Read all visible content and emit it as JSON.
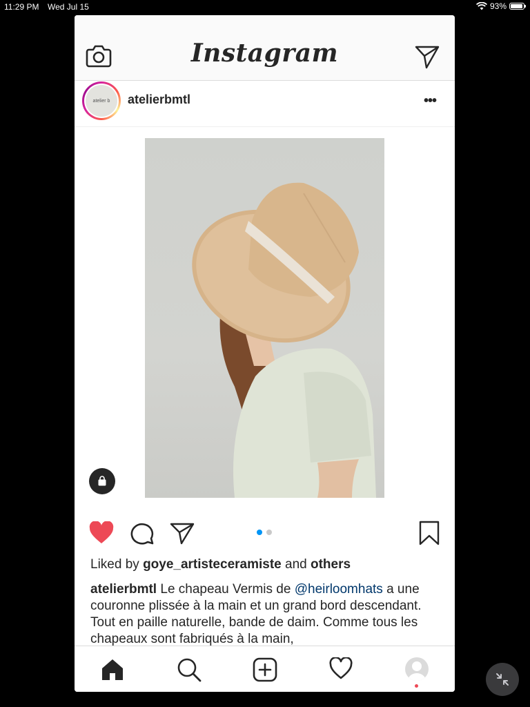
{
  "status_bar": {
    "time": "11:29 PM",
    "date": "Wed Jul 15",
    "battery": "93%",
    "battery_level": 0.93
  },
  "header": {
    "logo": "Instagram",
    "left_icon": "camera-icon",
    "right_icon": "direct-send-icon"
  },
  "post": {
    "username": "atelierbmtl",
    "avatar_text": "atelier b",
    "more_label": "•••",
    "carousel": {
      "count": 2,
      "active": 1
    },
    "liked": true,
    "like_color": "#ed4956",
    "likes": {
      "prefix": "Liked by",
      "user": "goye_artisteceramiste",
      "and": "and",
      "others": "others"
    },
    "caption": {
      "user": "atelierbmtl",
      "text_before": " Le  chapeau Vermis de ",
      "mention": "@heirloomhats",
      "text_after": " a une couronne plissée à la main et un grand bord descendant. Tout en paille naturelle, bande de daim. Comme tous les chapeaux sont fabriqués à la main,"
    }
  },
  "bottom_nav": {
    "items": [
      "home-icon",
      "search-icon",
      "new-post-icon",
      "activity-heart-icon",
      "profile-avatar"
    ],
    "active": "home-icon",
    "notification_color": "#ed4956"
  },
  "colors": {
    "accent": "#0095f6",
    "mention": "#00376b",
    "text": "#262626"
  }
}
